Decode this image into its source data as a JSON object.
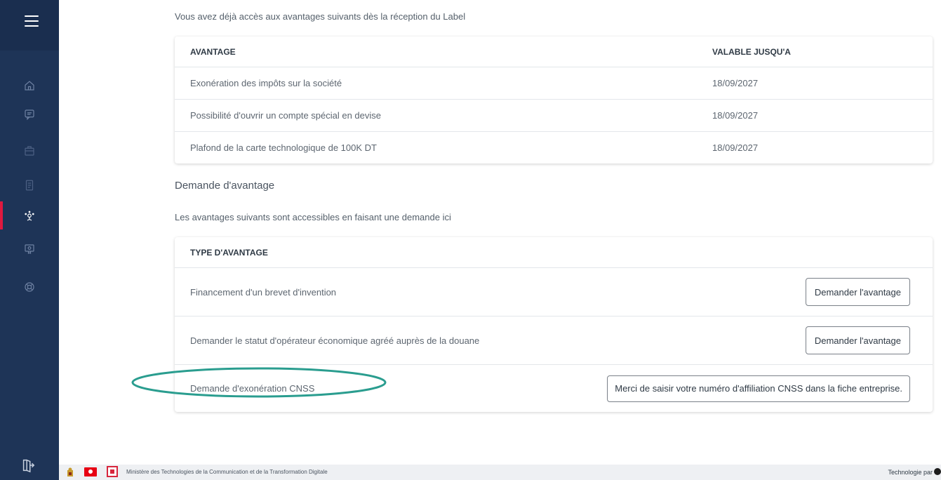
{
  "sidebar": {
    "icons": [
      "home-icon",
      "chat-icon",
      "briefcase-icon",
      "document-icon",
      "network-icon",
      "certificate-icon",
      "support-icon"
    ],
    "logout_icon": "logout-icon",
    "accent_color": "#e0193f",
    "bg_color": "#1e3457"
  },
  "avantages": {
    "intro": "Vous avez déjà accès aux avantages suivants dès la réception du Label",
    "headers": {
      "avantage": "AVANTAGE",
      "valable": "VALABLE JUSQU'A"
    },
    "rows": [
      {
        "label": "Exonération des impôts sur la société",
        "date": "18/09/2027"
      },
      {
        "label": "Possibilité d'ouvrir un compte spécial en devise",
        "date": "18/09/2027"
      },
      {
        "label": "Plafond de la carte technologique de 100K DT",
        "date": "18/09/2027"
      }
    ]
  },
  "demande": {
    "title": "Demande d'avantage",
    "intro": "Les avantages suivants sont accessibles en faisant une demande ici",
    "header": "TYPE D'AVANTAGE",
    "rows": [
      {
        "label": "Financement d'un brevet d'invention",
        "button": "Demander l'avantage"
      },
      {
        "label": "Demander le statut d'opérateur économique agréé auprès de la douane",
        "button": "Demander l'avantage"
      },
      {
        "label": "Demande d'exonération CNSS",
        "note": "Merci de saisir votre numéro d'affiliation CNSS dans la fiche entreprise."
      }
    ],
    "highlight_color": "#2a9d8f"
  },
  "footer": {
    "ministry": "Ministère des Technologies de la Communication et de la Transformation Digitale",
    "tech": "Technologie par"
  }
}
